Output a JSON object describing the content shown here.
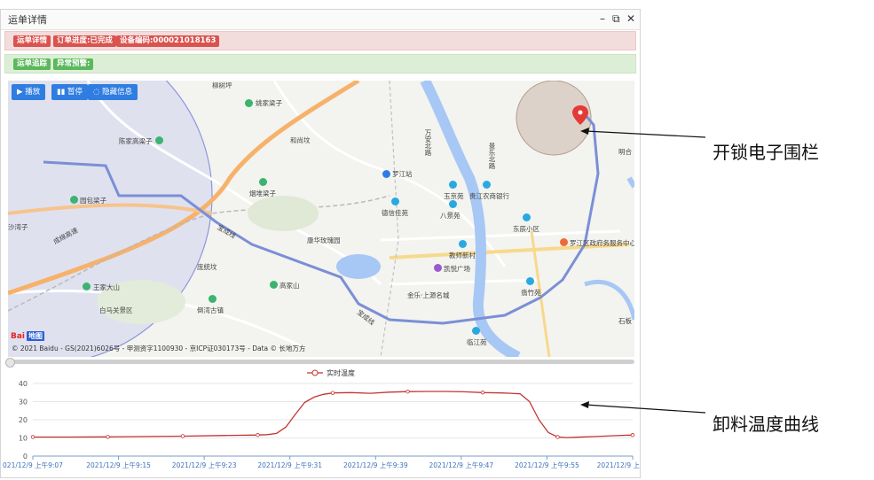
{
  "window": {
    "title": "运单详情",
    "controls": [
      "–",
      "⧉",
      "✕"
    ]
  },
  "status_bar": {
    "tags": [
      "运单详情",
      "订单进度:已完成",
      "设备编码:000021018163"
    ]
  },
  "tracking_bar": {
    "tags": [
      "运单追踪",
      "异常预警:"
    ]
  },
  "map_controls": {
    "play": "▶ 播放",
    "pause": "▮▮ 暂停",
    "hide_info": "◌ 隐藏信息"
  },
  "map_labels": {
    "poi": [
      "柳树坪",
      "姚家梁子",
      "陈家高梁子",
      "和尚坟",
      "烟堆梁子",
      "园包梁子",
      "沙湾子",
      "罗江站",
      "德信佳苑",
      "玉京苑",
      "贵江农商银行",
      "八景苑",
      "东辰小区",
      "罗江区政府务服务中心",
      "康华玫瑰园",
      "教师新村",
      "凯悦广场",
      "金乐·上源名城",
      "翡竹苑",
      "临江苑",
      "王家大山",
      "高家山",
      "白马关景区",
      "倒湾古镇",
      "庞统坟",
      "明合",
      "石板"
    ],
    "roads": [
      "万安北路",
      "景乐北路",
      "成绵高速",
      "宝成线",
      "宝成线"
    ],
    "copyright": "© 2021 Baidu - GS(2021)6026号 - 甲测资字1100930 - 京ICP证030173号 - Data © 长地万方",
    "logo": "Bai",
    "logo_du": "地图"
  },
  "annotations": {
    "fence": "开锁电子围栏",
    "temperature": "卸料温度曲线"
  },
  "colors": {
    "tag_red": "#d9534f",
    "tag_green": "#5cb85c",
    "button_blue": "#2f7de1",
    "route": "#7a8fd6",
    "series": "#c23531"
  },
  "chart_data": {
    "type": "line",
    "legend": "实时温度",
    "legend_position": "top",
    "ylim": [
      0,
      40
    ],
    "yticks": [
      0,
      10,
      20,
      30,
      40
    ],
    "grid": true,
    "xlabels": [
      "021/12/9 上午9:07",
      "2021/12/9 上午9:15",
      "2021/12/9 上午9:23",
      "2021/12/9 上午9:31",
      "2021/12/9 上午9:39",
      "2021/12/9 上午9:47",
      "2021/12/9 上午9:55",
      "2021/12/9 上"
    ],
    "series": [
      {
        "name": "实时温度",
        "x": [
          0,
          4,
          8,
          12,
          16,
          20,
          24,
          25,
          26,
          27,
          28,
          29,
          30,
          31,
          32,
          34,
          36,
          38,
          40,
          42,
          44,
          46,
          48,
          50,
          51,
          52,
          53,
          54,
          55,
          56,
          57,
          58,
          60,
          62,
          64
        ],
        "values": [
          10.5,
          10.5,
          10.6,
          10.8,
          11,
          11.3,
          11.6,
          11.8,
          12.5,
          16,
          23,
          29.5,
          32.5,
          34,
          34.8,
          35,
          34.6,
          35.2,
          35.5,
          35.6,
          35.6,
          35.4,
          35,
          34.8,
          34.6,
          34.3,
          30,
          20,
          13,
          10.5,
          10.2,
          10.4,
          10.8,
          11.2,
          11.6
        ]
      }
    ],
    "marker_x": [
      0,
      8,
      16,
      24,
      32,
      40,
      48,
      56,
      64
    ]
  }
}
